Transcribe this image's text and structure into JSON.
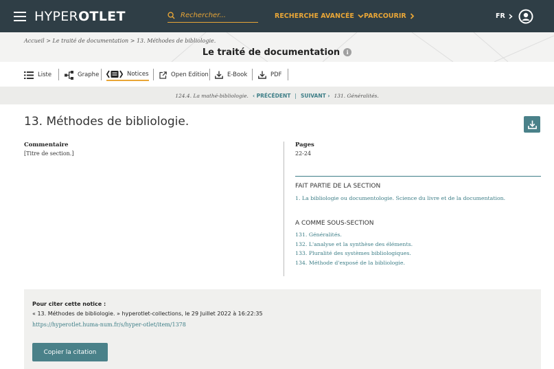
{
  "colors": {
    "navbar": "#2f3e46",
    "accent": "#e9a637",
    "teal": "#4a8189",
    "link": "#3d7e87"
  },
  "navbar": {
    "brand_light": "HYPER",
    "brand_bold": "OTLET",
    "search_placeholder": "Rechercher...",
    "advanced_search": "RECHERCHE AVANCÉE",
    "browse": "PARCOURIR",
    "language": "FR",
    "icons": {
      "menu": "hamburger-icon",
      "search": "search-icon",
      "user": "user-icon"
    }
  },
  "header": {
    "breadcrumb": [
      "Accueil",
      "Le traité de documentation",
      "13. Méthodes de bibliologie."
    ],
    "breadcrumb_sep": " > ",
    "title": "Le traité de documentation"
  },
  "tabs": [
    {
      "label": "Liste",
      "icon": "list-icon"
    },
    {
      "label": "Graphe",
      "icon": "graph-icon"
    },
    {
      "label": "Notices",
      "icon": "notices-icon",
      "active": true
    },
    {
      "label": "Open Edition",
      "icon": "external-link-icon"
    },
    {
      "label": "E-Book",
      "icon": "download-icon"
    },
    {
      "label": "PDF",
      "icon": "download-icon"
    }
  ],
  "pager": {
    "prev_item": "124.4. La mathé-bibliologie.",
    "prev_label": "PRÉCÉDENT",
    "next_label": "SUIVANT",
    "next_item": "131. Généralités."
  },
  "notice": {
    "title": "13. Méthodes de bibliologie.",
    "commentaire_label": "Commentaire",
    "commentaire_value": "[Titre de section.]",
    "pages_label": "Pages",
    "pages_value": "22-24",
    "parent_head": "FAIT PARTIE DE LA SECTION",
    "parent_item": "1. La bibliologie ou documentologie. Science du livre et de la documentation.",
    "children_head": "A COMME SOUS-SECTION",
    "children": [
      "131. Généralités.",
      "132. L'analyse et la synthèse des éléments.",
      "133. Pluralité des systèmes bibliologiques.",
      "134. Méthode d'exposé de la bibliologie."
    ]
  },
  "citation": {
    "label": "Pour citer cette notice :",
    "text": "« 13. Méthodes de bibliologie. » hyperotlet-collections, le 29 Juillet 2022 à 16:22:35",
    "url": "https://hyperotlet.huma-num.fr/s/hyper-otlet/item/1378",
    "button": "Copier la citation"
  }
}
